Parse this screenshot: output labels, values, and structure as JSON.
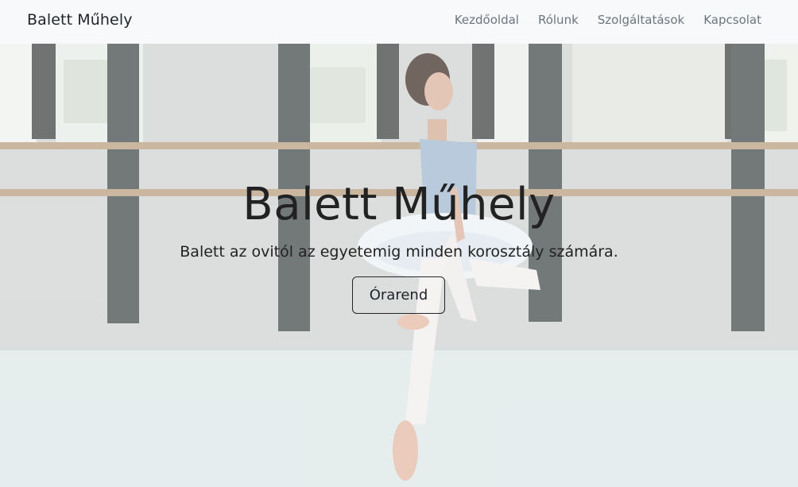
{
  "navbar": {
    "brand": "Balett Műhely",
    "links": [
      "Kezdőoldal",
      "Rólunk",
      "Szolgáltatások",
      "Kapcsolat"
    ]
  },
  "hero": {
    "title": "Balett Műhely",
    "subtitle": "Balett az ovitól az egyetemig minden korosztály számára.",
    "button_label": "Órarend"
  },
  "colors": {
    "navbar_bg": "#f8f9fa",
    "text_dark": "#212529",
    "nav_link": "#6c757d"
  }
}
